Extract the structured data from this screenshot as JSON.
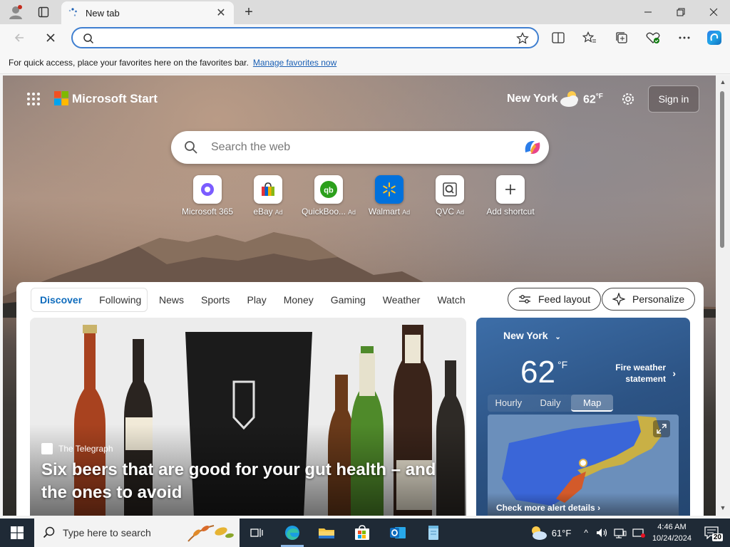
{
  "browser": {
    "tab_title": "New tab",
    "address_value": "",
    "favorites_bar_text": "For quick access, place your favorites here on the favorites bar.",
    "favorites_bar_link": "Manage favorites now"
  },
  "start": {
    "brand": "Microsoft Start",
    "city": "New York",
    "temp": "62",
    "temp_unit": "°F",
    "sign_in": "Sign in",
    "search_placeholder": "Search the web",
    "shortcuts": [
      {
        "label": "Microsoft 365",
        "ad": "",
        "icon": "microsoft365-icon"
      },
      {
        "label": "eBay",
        "ad": "Ad",
        "icon": "ebay-icon"
      },
      {
        "label": "QuickBoo...",
        "ad": "Ad",
        "icon": "quickbooks-icon"
      },
      {
        "label": "Walmart",
        "ad": "Ad",
        "icon": "walmart-icon"
      },
      {
        "label": "QVC",
        "ad": "Ad",
        "icon": "qvc-icon"
      },
      {
        "label": "Add shortcut",
        "ad": "",
        "icon": "plus-icon"
      }
    ]
  },
  "feed": {
    "tabs": [
      "Discover",
      "Following"
    ],
    "links": [
      "News",
      "Sports",
      "Play",
      "Money",
      "Gaming",
      "Weather",
      "Watch"
    ],
    "feed_layout": "Feed layout",
    "personalize": "Personalize",
    "hero": {
      "source": "The Telegraph",
      "title": "Six beers that are good for your gut health – and the ones to avoid"
    }
  },
  "weather_card": {
    "city": "New York",
    "temp": "62",
    "unit": "°F",
    "alert": "Fire weather statement",
    "tabs": [
      "Hourly",
      "Daily",
      "Map"
    ],
    "active_tab": "Map",
    "more": "Check more alert details"
  },
  "taskbar": {
    "search_placeholder": "Type here to search",
    "temp": "61°F",
    "time": "4:46 AM",
    "date": "10/24/2024",
    "notifications": "20"
  },
  "colors": {
    "accent": "#0f6cbd",
    "address_border": "#3f7fd0",
    "taskbar": "#1f2a36"
  }
}
